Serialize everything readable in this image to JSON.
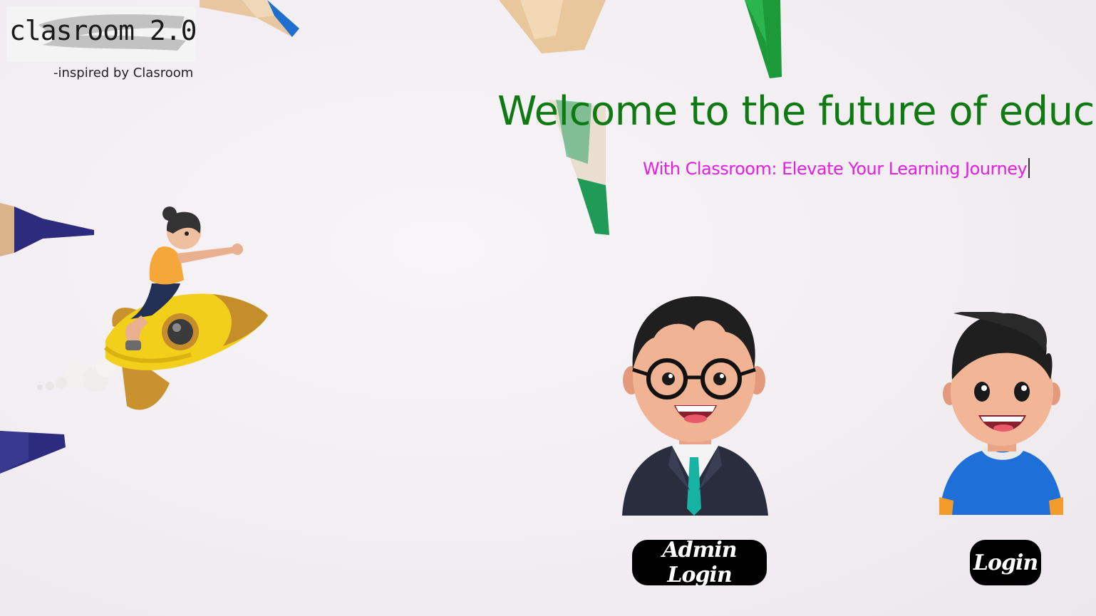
{
  "logo": {
    "title": "clasroom 2.0",
    "tagline": "-inspired by Clasroom"
  },
  "hero": {
    "headline": "Welcome to the future of educa",
    "subheadline": "With Classroom: Elevate Your Learning Journey"
  },
  "actions": {
    "admin_login_label": "Admin Login",
    "login_label": "Login"
  },
  "colors": {
    "headline": "#0f7a12",
    "subheadline": "#e41ee4",
    "button_bg": "#000000",
    "button_text": "#ffffff"
  }
}
